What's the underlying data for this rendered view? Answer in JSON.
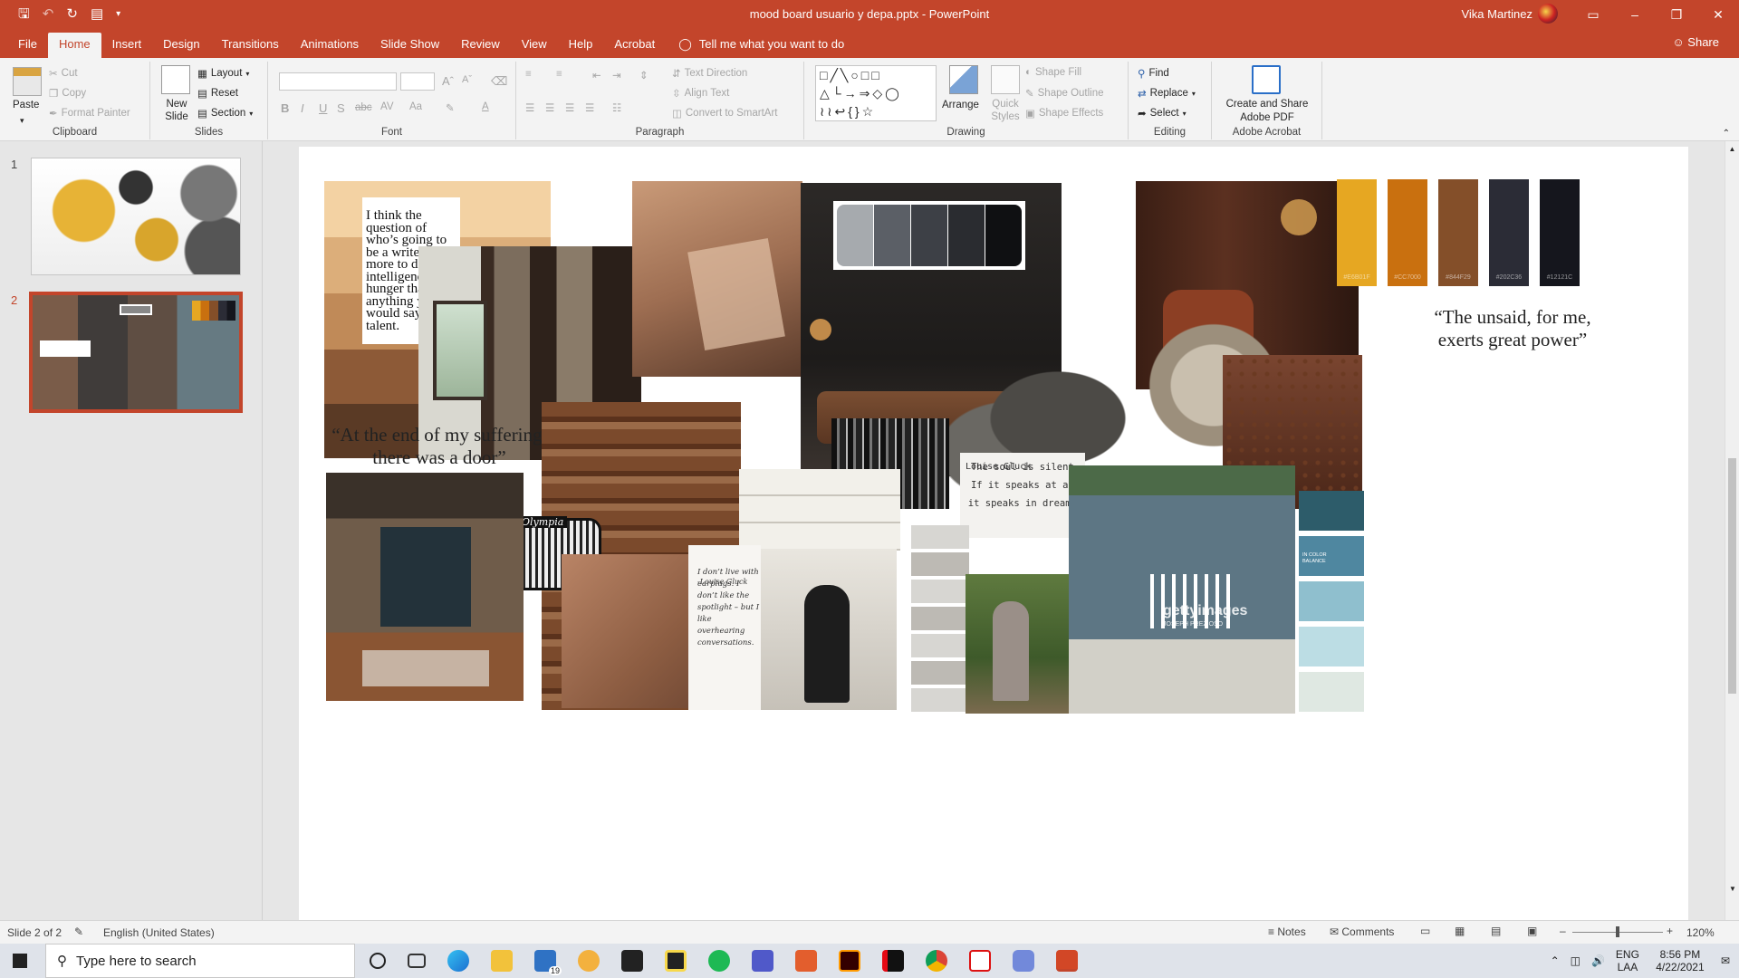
{
  "app": {
    "doc_title": "mood board usuario y depa.pptx  -  PowerPoint",
    "user_name": "Vika Martinez",
    "window_controls": [
      "▭",
      "–",
      "❐",
      "✕"
    ]
  },
  "tabs": [
    "File",
    "Home",
    "Insert",
    "Design",
    "Transitions",
    "Animations",
    "Slide Show",
    "Review",
    "View",
    "Help",
    "Acrobat"
  ],
  "active_tab": "Home",
  "tell_me": "Tell me what you want to do",
  "share": "Share",
  "ribbon": {
    "clipboard": {
      "paste": "Paste",
      "cut": "Cut",
      "copy": "Copy",
      "format_painter": "Format Painter",
      "label": "Clipboard"
    },
    "slides": {
      "new_slide": "New Slide",
      "layout": "Layout",
      "reset": "Reset",
      "section": "Section",
      "label": "Slides"
    },
    "font": {
      "label": "Font",
      "bold": "B",
      "italic": "I",
      "underline": "U",
      "shadow": "S",
      "strike": "abc",
      "spacing": "AV",
      "case": "Aa",
      "color": "A"
    },
    "paragraph": {
      "text_direction": "Text Direction",
      "align_text": "Align Text",
      "smartart": "Convert to SmartArt",
      "label": "Paragraph"
    },
    "drawing": {
      "arrange": "Arrange",
      "quick_styles": "Quick Styles",
      "shape_fill": "Shape Fill",
      "shape_outline": "Shape Outline",
      "shape_effects": "Shape Effects",
      "label": "Drawing"
    },
    "editing": {
      "find": "Find",
      "replace": "Replace",
      "select": "Select",
      "label": "Editing"
    },
    "acrobat": {
      "create": "Create and Share Adobe PDF",
      "label": "Adobe Acrobat"
    }
  },
  "slides_pane": {
    "numbers": [
      "1",
      "2"
    ],
    "selected": 2
  },
  "slide": {
    "quote_writer": "I think the question of who’s going to be a writer has more to do with intelligence and hunger than anything you would say was talent.",
    "quote_suffering": "“At the end of my suffering, there was a door”",
    "quote_unsaid": "“The unsaid, for me, exerts great power”",
    "quote_soul": "The soul is silent. If it speaks at all it speaks in dreams.",
    "quote_soul_author": "Louise Gluck",
    "quote_earplugs": "I don’t live with earplugs. I don’t like the spotlight – but I like overhearing conversations.",
    "quote_earplugs_author": "-Louise Gluck",
    "palette_warm": [
      {
        "color": "#e6a722",
        "code": "#E6B01F"
      },
      {
        "color": "#c9700f",
        "code": "#CC7000"
      },
      {
        "color": "#844f29",
        "code": "#844F29"
      },
      {
        "color": "#2b2c36",
        "code": "#202C36"
      },
      {
        "color": "#15161d",
        "code": "#12121C"
      }
    ],
    "palette_gray": [
      "#a6aaae",
      "#5b5f66",
      "#3d4046",
      "#2a2c30",
      "#0f1012"
    ],
    "palette_brown": [
      "#f3d2a3",
      "#dcae7a",
      "#c08a58",
      "#8d5a37",
      "#5a3a25"
    ],
    "palette_blue": [
      "#2d5c6a",
      "#4f87a0",
      "#8fbfce",
      "#bcdde4",
      "#dfe8e2"
    ],
    "blue_palette_text": "IN COLOR BALANCE",
    "getty_text": "gettyimages",
    "getty_sub": "JOSEPH PREZIOSO",
    "typewriter_brand": "Olympia"
  },
  "statusbar": {
    "slide_info": "Slide 2 of 2",
    "language": "English (United States)",
    "notes": "Notes",
    "comments": "Comments",
    "zoom": "120%"
  },
  "taskbar": {
    "search_placeholder": "Type here to search",
    "mail_badge": "19",
    "lang": "ENG",
    "region": "LAA",
    "time": "8:56 PM",
    "date": "4/22/2021"
  }
}
